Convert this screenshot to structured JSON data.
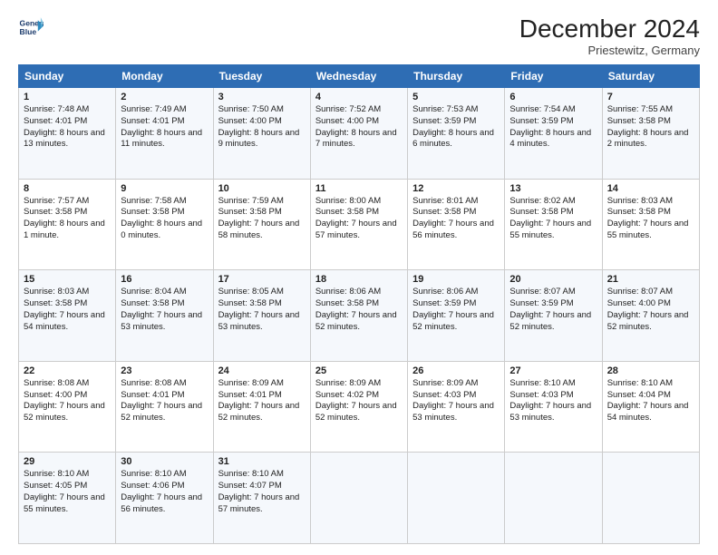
{
  "header": {
    "logo_line1": "General",
    "logo_line2": "Blue",
    "title": "December 2024",
    "location": "Priestewitz, Germany"
  },
  "days_of_week": [
    "Sunday",
    "Monday",
    "Tuesday",
    "Wednesday",
    "Thursday",
    "Friday",
    "Saturday"
  ],
  "weeks": [
    [
      {
        "day": "1",
        "rise": "7:48 AM",
        "set": "4:01 PM",
        "daylight": "8 hours and 13 minutes."
      },
      {
        "day": "2",
        "rise": "7:49 AM",
        "set": "4:01 PM",
        "daylight": "8 hours and 11 minutes."
      },
      {
        "day": "3",
        "rise": "7:50 AM",
        "set": "4:00 PM",
        "daylight": "8 hours and 9 minutes."
      },
      {
        "day": "4",
        "rise": "7:52 AM",
        "set": "4:00 PM",
        "daylight": "8 hours and 7 minutes."
      },
      {
        "day": "5",
        "rise": "7:53 AM",
        "set": "3:59 PM",
        "daylight": "8 hours and 6 minutes."
      },
      {
        "day": "6",
        "rise": "7:54 AM",
        "set": "3:59 PM",
        "daylight": "8 hours and 4 minutes."
      },
      {
        "day": "7",
        "rise": "7:55 AM",
        "set": "3:58 PM",
        "daylight": "8 hours and 2 minutes."
      }
    ],
    [
      {
        "day": "8",
        "rise": "7:57 AM",
        "set": "3:58 PM",
        "daylight": "8 hours and 1 minute."
      },
      {
        "day": "9",
        "rise": "7:58 AM",
        "set": "3:58 PM",
        "daylight": "8 hours and 0 minutes."
      },
      {
        "day": "10",
        "rise": "7:59 AM",
        "set": "3:58 PM",
        "daylight": "7 hours and 58 minutes."
      },
      {
        "day": "11",
        "rise": "8:00 AM",
        "set": "3:58 PM",
        "daylight": "7 hours and 57 minutes."
      },
      {
        "day": "12",
        "rise": "8:01 AM",
        "set": "3:58 PM",
        "daylight": "7 hours and 56 minutes."
      },
      {
        "day": "13",
        "rise": "8:02 AM",
        "set": "3:58 PM",
        "daylight": "7 hours and 55 minutes."
      },
      {
        "day": "14",
        "rise": "8:03 AM",
        "set": "3:58 PM",
        "daylight": "7 hours and 55 minutes."
      }
    ],
    [
      {
        "day": "15",
        "rise": "8:03 AM",
        "set": "3:58 PM",
        "daylight": "7 hours and 54 minutes."
      },
      {
        "day": "16",
        "rise": "8:04 AM",
        "set": "3:58 PM",
        "daylight": "7 hours and 53 minutes."
      },
      {
        "day": "17",
        "rise": "8:05 AM",
        "set": "3:58 PM",
        "daylight": "7 hours and 53 minutes."
      },
      {
        "day": "18",
        "rise": "8:06 AM",
        "set": "3:58 PM",
        "daylight": "7 hours and 52 minutes."
      },
      {
        "day": "19",
        "rise": "8:06 AM",
        "set": "3:59 PM",
        "daylight": "7 hours and 52 minutes."
      },
      {
        "day": "20",
        "rise": "8:07 AM",
        "set": "3:59 PM",
        "daylight": "7 hours and 52 minutes."
      },
      {
        "day": "21",
        "rise": "8:07 AM",
        "set": "4:00 PM",
        "daylight": "7 hours and 52 minutes."
      }
    ],
    [
      {
        "day": "22",
        "rise": "8:08 AM",
        "set": "4:00 PM",
        "daylight": "7 hours and 52 minutes."
      },
      {
        "day": "23",
        "rise": "8:08 AM",
        "set": "4:01 PM",
        "daylight": "7 hours and 52 minutes."
      },
      {
        "day": "24",
        "rise": "8:09 AM",
        "set": "4:01 PM",
        "daylight": "7 hours and 52 minutes."
      },
      {
        "day": "25",
        "rise": "8:09 AM",
        "set": "4:02 PM",
        "daylight": "7 hours and 52 minutes."
      },
      {
        "day": "26",
        "rise": "8:09 AM",
        "set": "4:03 PM",
        "daylight": "7 hours and 53 minutes."
      },
      {
        "day": "27",
        "rise": "8:10 AM",
        "set": "4:03 PM",
        "daylight": "7 hours and 53 minutes."
      },
      {
        "day": "28",
        "rise": "8:10 AM",
        "set": "4:04 PM",
        "daylight": "7 hours and 54 minutes."
      }
    ],
    [
      {
        "day": "29",
        "rise": "8:10 AM",
        "set": "4:05 PM",
        "daylight": "7 hours and 55 minutes."
      },
      {
        "day": "30",
        "rise": "8:10 AM",
        "set": "4:06 PM",
        "daylight": "7 hours and 56 minutes."
      },
      {
        "day": "31",
        "rise": "8:10 AM",
        "set": "4:07 PM",
        "daylight": "7 hours and 57 minutes."
      },
      null,
      null,
      null,
      null
    ]
  ]
}
